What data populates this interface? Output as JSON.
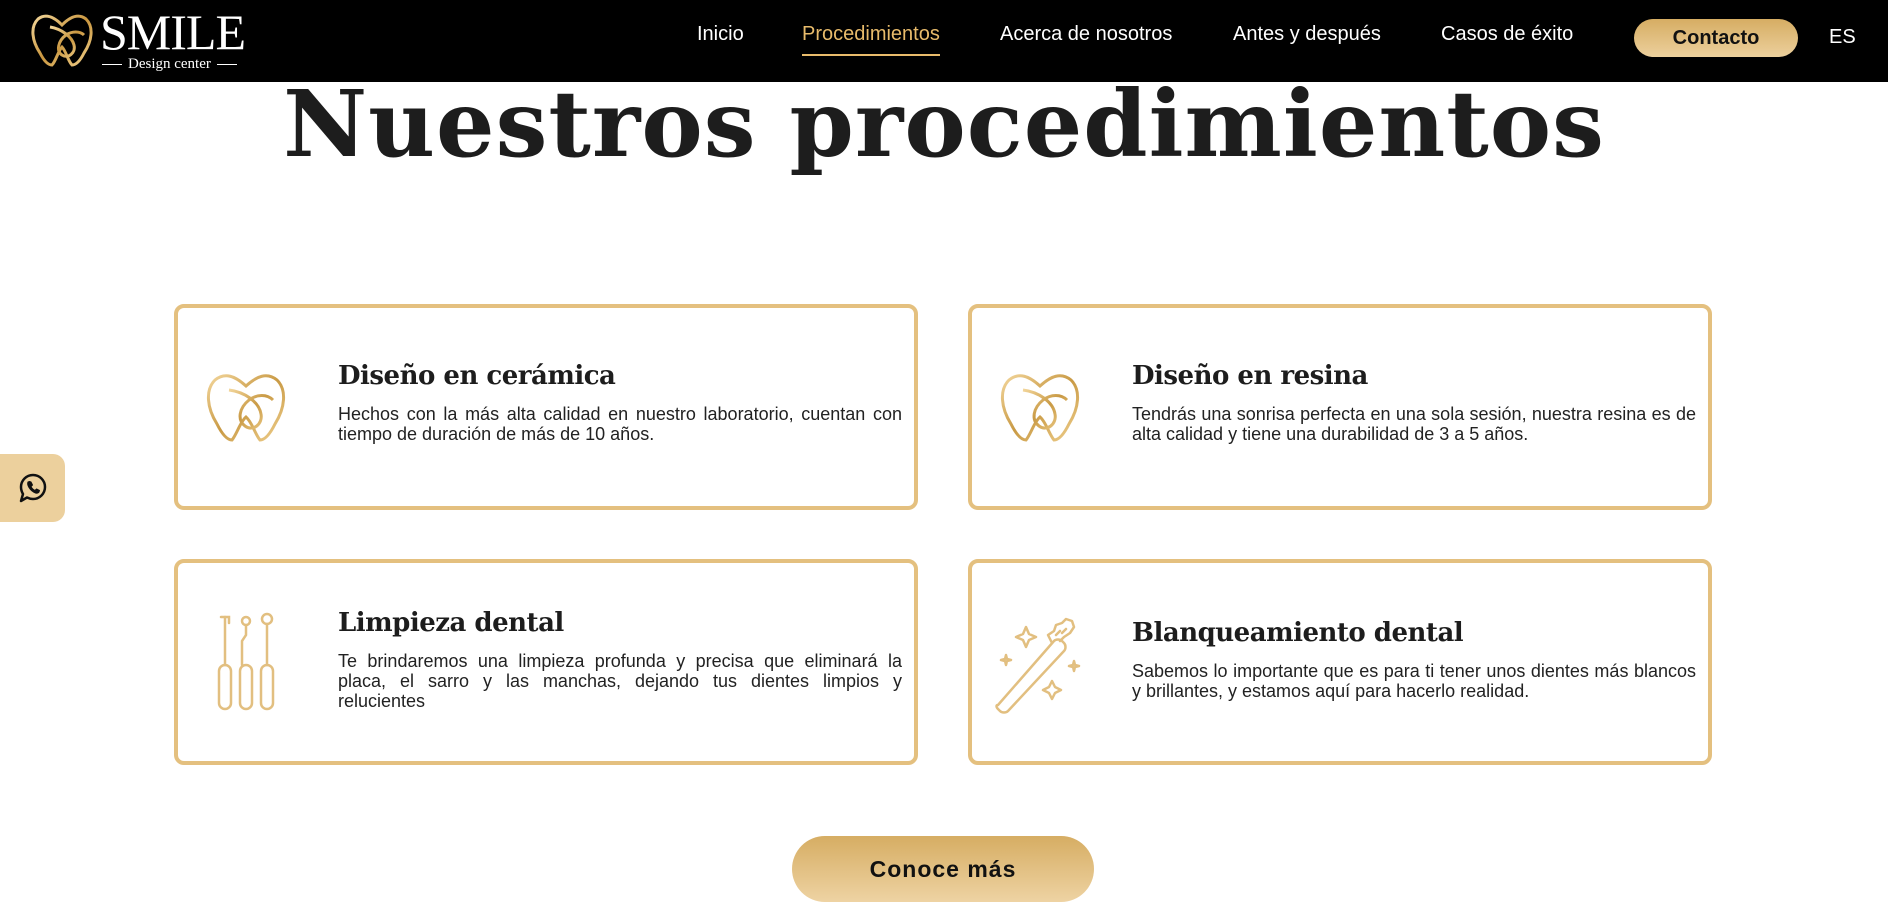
{
  "header": {
    "logo": {
      "main": "SMILE",
      "sub": "Design center"
    },
    "nav": [
      {
        "label": "Inicio"
      },
      {
        "label": "Procedimientos"
      },
      {
        "label": "Acerca de nosotros"
      },
      {
        "label": "Antes y después"
      },
      {
        "label": "Casos de éxito"
      }
    ],
    "active_nav": "Procedimientos",
    "contact_label": "Contacto",
    "language": "ES"
  },
  "main": {
    "title": "Nuestros procedimientos",
    "cards": [
      {
        "title": "Diseño en cerámica",
        "text": "Hechos con la más alta calidad en nuestro laboratorio, cuentan con tiempo de duración de más de 10 años.",
        "icon": "tooth-icon"
      },
      {
        "title": "Diseño en resina",
        "text": "Tendrás una sonrisa perfecta en una sola sesión, nuestra resina es de alta calidad y tiene una durabilidad de 3 a 5 años.",
        "icon": "tooth-icon"
      },
      {
        "title": "Limpieza dental",
        "text": "Te brindaremos una limpieza profunda y precisa que eliminará la placa, el sarro y las manchas, dejando tus dientes limpios y relucientes",
        "icon": "dental-tools-icon"
      },
      {
        "title": "Blanqueamiento dental",
        "text": "Sabemos lo importante que es para ti tener unos dientes más blancos y brillantes, y estamos aquí para hacerlo realidad.",
        "icon": "toothbrush-sparkle-icon"
      }
    ],
    "cta_label": "Conoce más"
  },
  "floating": {
    "icon": "whatsapp-icon"
  },
  "colors": {
    "gold": "#e4c07f",
    "accent": "#e8bb6b",
    "header_bg": "#000000"
  }
}
